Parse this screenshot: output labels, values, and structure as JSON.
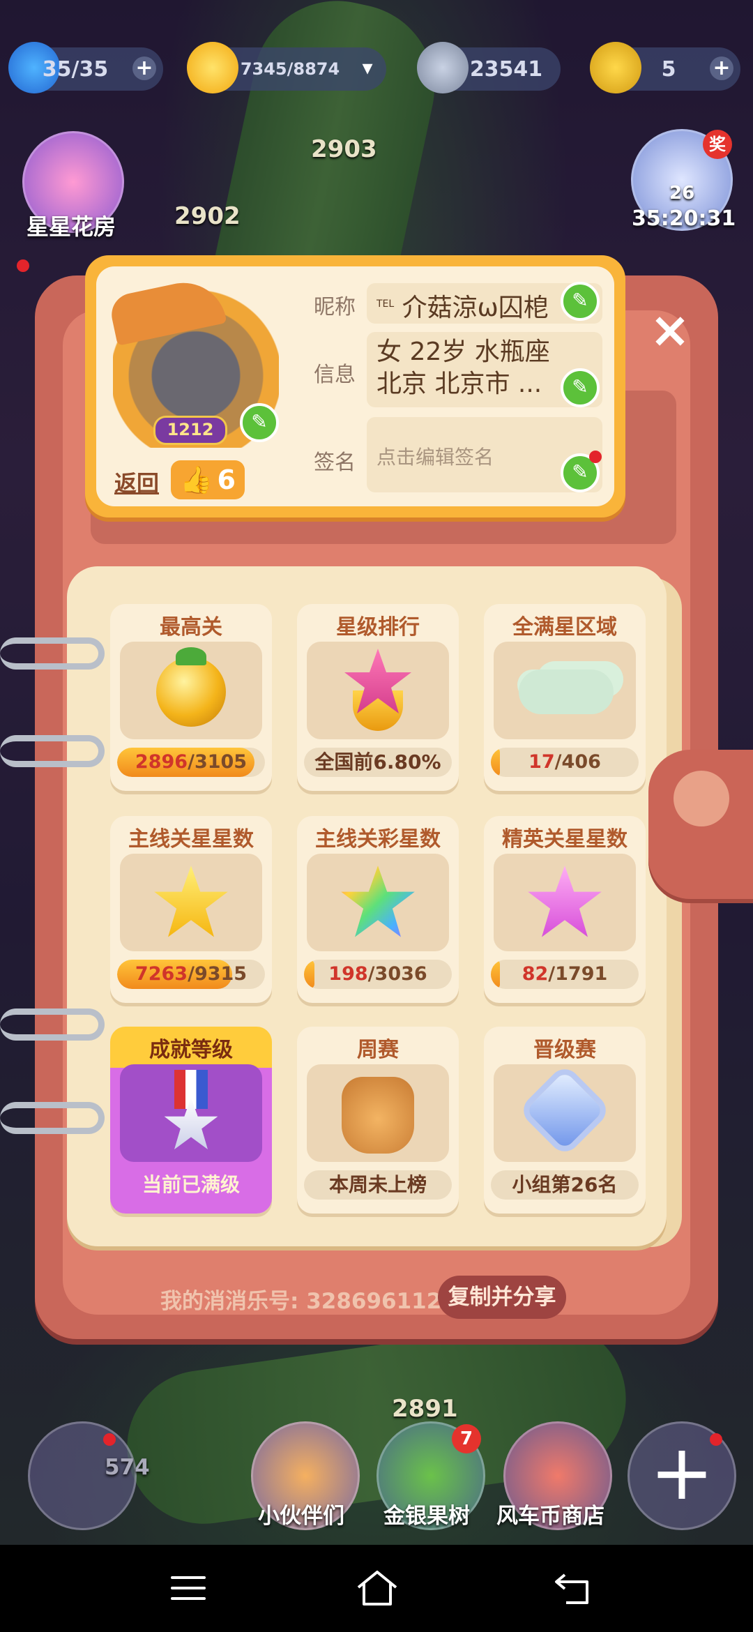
{
  "top_bar": {
    "energy": "35/35",
    "stars": "7345/8874",
    "coins": "23541",
    "windmill": "5",
    "plus": "+"
  },
  "map_levels": [
    "2903",
    "2902",
    "2891"
  ],
  "side_buttons": {
    "left_label": "星星花房",
    "right_timer": "35:20:31",
    "right_badge": "奖",
    "right_level": "26"
  },
  "profile": {
    "avatar_level": "1212",
    "back_label": "返回",
    "likes": "6",
    "nickname_label": "昵称",
    "nickname_prefix": "TEL",
    "nickname_value": "介菇涼ω囚梎",
    "info_label": "信息",
    "info_line1": "女 22岁 水瓶座",
    "info_line2": "北京 北京市 ...",
    "sign_label": "签名",
    "sign_placeholder": "点击编辑签名",
    "close": "×"
  },
  "stats": [
    {
      "title": "最高关",
      "current": "2896",
      "total": "3105",
      "progress": 0.93
    },
    {
      "title": "星级排行",
      "text": "全国前6.80%"
    },
    {
      "title": "全满星区域",
      "current": "17",
      "total": "406",
      "progress": 0.04
    },
    {
      "title": "主线关星星数",
      "current": "7263",
      "total": "9315",
      "progress": 0.78
    },
    {
      "title": "主线关彩星数",
      "current": "198",
      "total": "3036",
      "progress": 0.07
    },
    {
      "title": "精英关星星数",
      "current": "82",
      "total": "1791",
      "progress": 0.05
    },
    {
      "title": "成就等级",
      "text": "当前已满级"
    },
    {
      "title": "周赛",
      "text": "本周未上榜"
    },
    {
      "title": "晋级赛",
      "text": "小组第26名"
    }
  ],
  "footer": {
    "account_label": "我的消消乐号: 328696112",
    "copy_share": "复制并分享"
  },
  "bottom_nav": {
    "item1_value": "574",
    "item2_label": "小伙伴们",
    "item3_label": "金银果树",
    "item3_badge": "7",
    "item4_label": "风车币商店"
  },
  "colors": {
    "accent_orange": "#f9b43a",
    "book_red": "#c9675a",
    "edit_green": "#5cc13a",
    "progress_orange": "#f18a1c"
  }
}
